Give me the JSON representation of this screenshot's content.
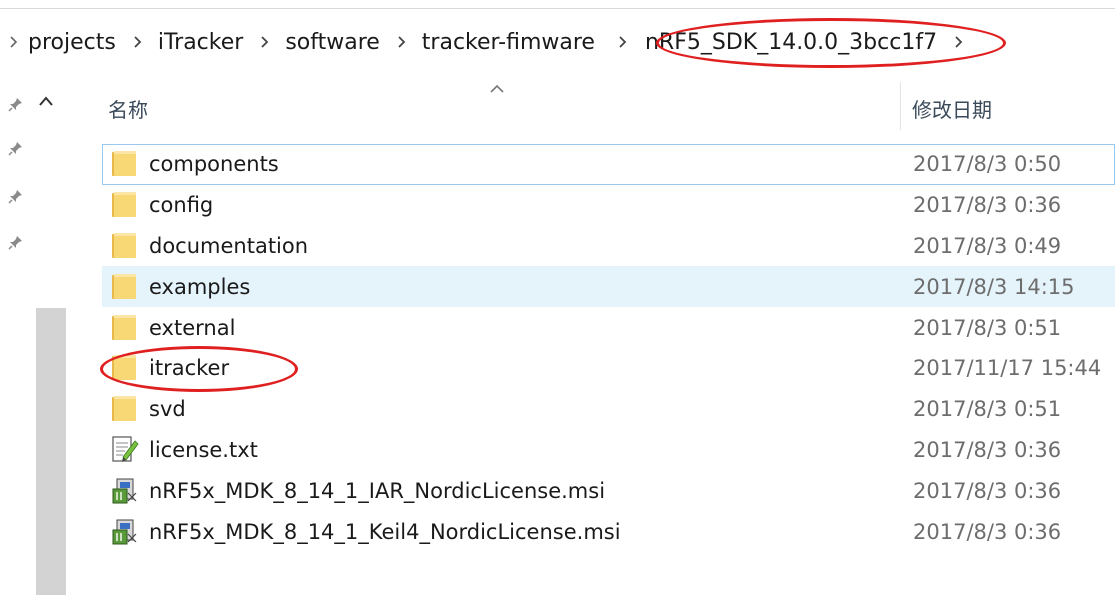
{
  "breadcrumb": {
    "items": [
      "projects",
      "iTracker",
      "software",
      "tracker-fimware",
      "nRF5_SDK_14.0.0_3bcc1f7"
    ]
  },
  "header": {
    "name_label": "名称",
    "date_label": "修改日期"
  },
  "files": [
    {
      "name": "components",
      "date": "2017/8/3 0:50",
      "type": "folder"
    },
    {
      "name": "config",
      "date": "2017/8/3 0:36",
      "type": "folder"
    },
    {
      "name": "documentation",
      "date": "2017/8/3 0:49",
      "type": "folder"
    },
    {
      "name": "examples",
      "date": "2017/8/3 14:15",
      "type": "folder"
    },
    {
      "name": "external",
      "date": "2017/8/3 0:51",
      "type": "folder"
    },
    {
      "name": "itracker",
      "date": "2017/11/17 15:44",
      "type": "folder"
    },
    {
      "name": "svd",
      "date": "2017/8/3 0:51",
      "type": "folder"
    },
    {
      "name": "license.txt",
      "date": "2017/8/3 0:36",
      "type": "text-file"
    },
    {
      "name": "nRF5x_MDK_8_14_1_IAR_NordicLicense.msi",
      "date": "2017/8/3 0:36",
      "type": "installer"
    },
    {
      "name": "nRF5x_MDK_8_14_1_Keil4_NordicLicense.msi",
      "date": "2017/8/3 0:36",
      "type": "installer"
    }
  ],
  "colors": {
    "annotation": "#e02020",
    "hover_row": "#e5f3fb",
    "focus_border": "#99c9ef",
    "folder": "#f8d775"
  }
}
